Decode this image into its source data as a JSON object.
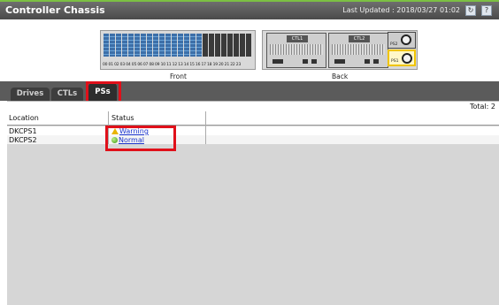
{
  "window": {
    "title": "Controller Chassis",
    "last_updated": "Last Updated : 2018/03/27 01:02",
    "refresh_icon": "refresh-icon",
    "help_icon": "help-icon"
  },
  "chassis": {
    "front_caption": "Front",
    "back_caption": "Back",
    "slot_numbers": "00 01 02 03 04 05 06 07 08 09 10 11 12 13 14 15 16 17 18 19 20 21 22 23",
    "ctl_labels": [
      "CTL1",
      "CTL2"
    ],
    "ps_labels": [
      "PS2",
      "PS1"
    ]
  },
  "tabs": [
    {
      "label": "Drives"
    },
    {
      "label": "CTLs"
    },
    {
      "label": "PSs"
    }
  ],
  "table": {
    "total": "Total: 2",
    "columns": [
      "Location",
      "Status"
    ],
    "rows": [
      {
        "location": "DKCPS1",
        "status": "Warning"
      },
      {
        "location": "DKCPS2",
        "status": "Normal"
      }
    ]
  },
  "colors": {
    "accent_green": "#7cc043",
    "highlight_red": "#e0101a",
    "warning": "#e8b400",
    "link": "#1a33cc"
  }
}
